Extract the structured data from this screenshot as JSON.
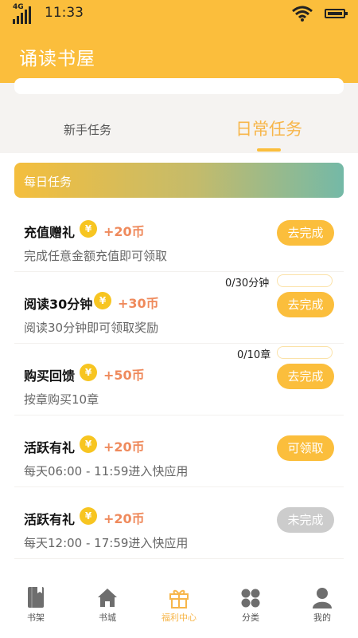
{
  "status": {
    "network": "4G",
    "time": "11:33"
  },
  "app": {
    "title": "诵读书屋"
  },
  "tabs": [
    {
      "label": "新手任务",
      "active": false
    },
    {
      "label": "日常任务",
      "active": true
    }
  ],
  "banner": {
    "title": "每日任务"
  },
  "tasks": [
    {
      "title": "充值赠礼",
      "coin": "¥",
      "reward": "+20币",
      "desc": "完成任意金额充值即可领取",
      "button": "去完成",
      "state": "todo"
    },
    {
      "title": "阅读30分钟",
      "coin": "¥",
      "reward": "+30币",
      "desc": "阅读30分钟即可领取奖励",
      "button": "去完成",
      "state": "todo",
      "progress_label": "0/30分钟",
      "progress": 0
    },
    {
      "title": "购买回馈",
      "coin": "¥",
      "reward": "+50币",
      "desc": "按章购买10章",
      "button": "去完成",
      "state": "todo",
      "progress_label": "0/10章",
      "progress": 0
    },
    {
      "title": "活跃有礼",
      "coin": "¥",
      "reward": "+20币",
      "desc": "每天06:00 - 11:59进入快应用",
      "button": "可领取",
      "state": "claimable"
    },
    {
      "title": "活跃有礼",
      "coin": "¥",
      "reward": "+20币",
      "desc": "每天12:00 - 17:59进入快应用",
      "button": "未完成",
      "state": "incomplete"
    }
  ],
  "tabbar": [
    {
      "label": "书架",
      "icon": "bookshelf-icon",
      "active": false
    },
    {
      "label": "书城",
      "icon": "home-icon",
      "active": false
    },
    {
      "label": "福利中心",
      "icon": "gift-icon",
      "active": true
    },
    {
      "label": "分类",
      "icon": "category-icon",
      "active": false
    },
    {
      "label": "我的",
      "icon": "user-icon",
      "active": false
    }
  ],
  "colors": {
    "primary": "#fbbe3c",
    "reward": "#ef8a5c",
    "disabled": "#cccccc",
    "banner_end": "#74b9a7"
  }
}
